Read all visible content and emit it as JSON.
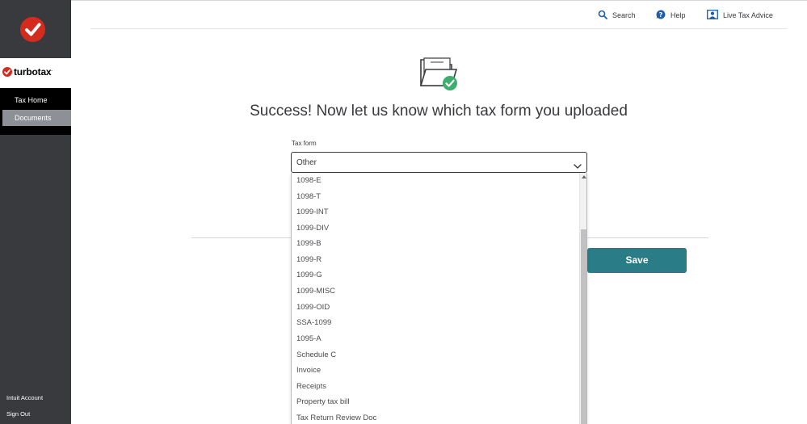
{
  "sidebar": {
    "brand_name": "turbotax",
    "brand_mark": ".",
    "nav": [
      {
        "label": "Tax Home"
      },
      {
        "label": "Documents"
      }
    ],
    "footer": {
      "account": "Intuit Account",
      "sign_out": "Sign Out"
    }
  },
  "header": {
    "search": "Search",
    "help": "Help",
    "live_advice": "Live Tax Advice"
  },
  "main": {
    "title": "Success! Now let us know which tax form you uploaded",
    "field_label": "Tax form",
    "selected_value": "Other",
    "save_label": "Save",
    "options": [
      "1098-E",
      "1098-T",
      "1099-INT",
      "1099-DIV",
      "1099-B",
      "1099-R",
      "1099-G",
      "1099-MISC",
      "1099-OID",
      "SSA-1099",
      "1095-A",
      "Schedule C",
      "Invoice",
      "Receipts",
      "Property tax bill",
      "Tax Return Review Doc"
    ]
  },
  "colors": {
    "brand_red": "#d52b1e",
    "sidebar_bg": "#393a3d",
    "save_button": "#2a7c87",
    "success_check": "#3cae6e",
    "header_icon": "#1e5fa8"
  }
}
